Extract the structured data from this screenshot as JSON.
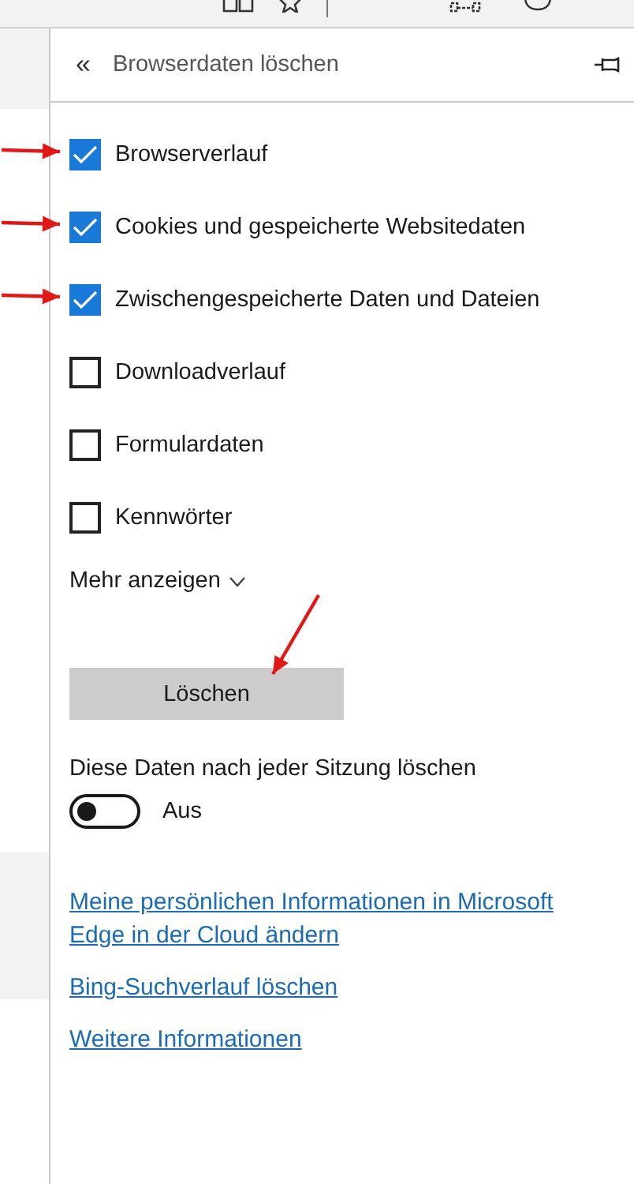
{
  "panel": {
    "back_glyph": "«",
    "title": "Browserdaten löschen"
  },
  "options": [
    {
      "label": "Browserverlauf",
      "checked": true,
      "annotated": true
    },
    {
      "label": "Cookies und gespeicherte Websitedaten",
      "checked": true,
      "annotated": true
    },
    {
      "label": "Zwischengespeicherte Daten und Dateien",
      "checked": true,
      "annotated": true
    },
    {
      "label": "Downloadverlauf",
      "checked": false,
      "annotated": false
    },
    {
      "label": "Formulardaten",
      "checked": false,
      "annotated": false
    },
    {
      "label": "Kennwörter",
      "checked": false,
      "annotated": false
    }
  ],
  "more": {
    "label": "Mehr anzeigen",
    "expanded": false
  },
  "delete_button": {
    "label": "Löschen",
    "annotated": true
  },
  "auto_clear": {
    "label": "Diese Daten nach jeder Sitzung löschen",
    "on": false,
    "state_text": "Aus"
  },
  "links": [
    "Meine persönlichen Informationen in Microsoft Edge in der Cloud ändern",
    "Bing-Suchverlauf löschen",
    "Weitere Informationen"
  ]
}
